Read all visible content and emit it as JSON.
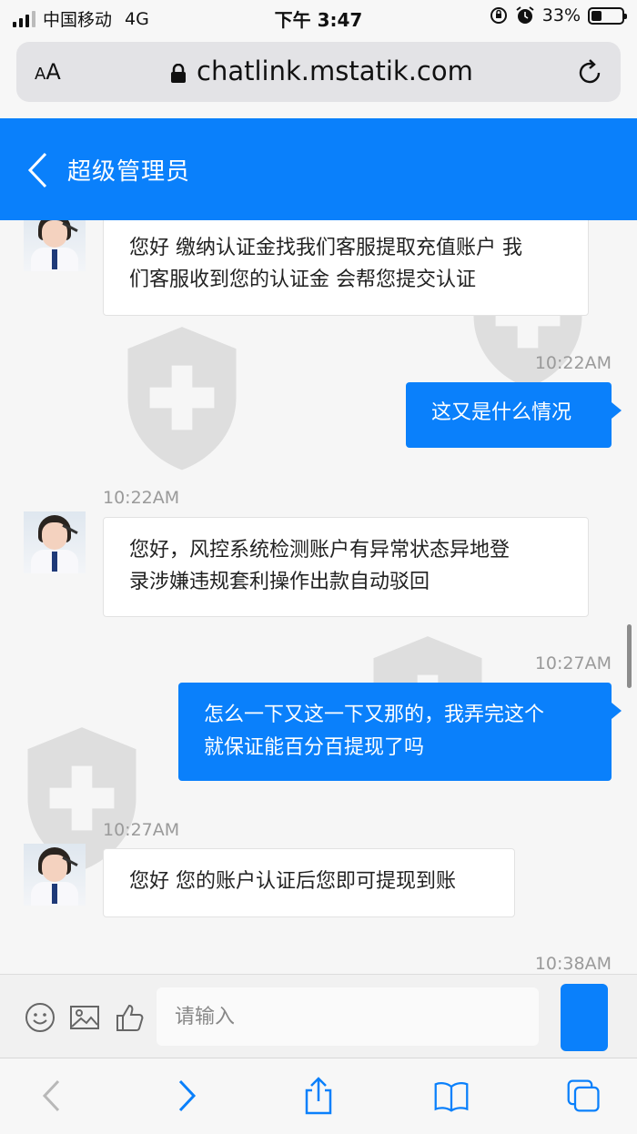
{
  "status_bar": {
    "carrier": "中国移动",
    "network": "4G",
    "time": "下午 3:47",
    "battery_percent": "33%",
    "battery_level": 0.33
  },
  "browser": {
    "text_size_label_small": "A",
    "text_size_label_large": "A",
    "url": "chatlink.mstatik.com"
  },
  "header": {
    "title": "超级管理员"
  },
  "messages": [
    {
      "direction": "in",
      "lines": [
        "您好 缴纳认证金找我们客服提取充值账户 我",
        "们客服收到您的认证金 会帮您提交认证"
      ]
    },
    {
      "direction": "out",
      "time": "10:22AM",
      "lines": [
        "这又是什么情况"
      ]
    },
    {
      "direction": "in",
      "time": "10:22AM",
      "lines": [
        "您好，风控系统检测账户有异常状态异地登",
        "录涉嫌违规套利操作出款自动驳回"
      ]
    },
    {
      "direction": "out",
      "time": "10:27AM",
      "lines": [
        "怎么一下又这一下又那的，我弄完这个",
        "就保证能百分百提现了吗"
      ]
    },
    {
      "direction": "in",
      "time": "10:27AM",
      "lines": [
        "您好 您的账户认证后您即可提现到账"
      ]
    },
    {
      "direction": "out",
      "time": "10:38AM",
      "lines": []
    }
  ],
  "input_bar": {
    "placeholder": "请输入",
    "icons": [
      "emoji-icon",
      "image-icon",
      "thumbs-up-icon"
    ]
  },
  "toolbar": {
    "icons": [
      "back-icon",
      "forward-icon",
      "share-icon",
      "bookmarks-icon",
      "tabs-icon"
    ]
  },
  "colors": {
    "accent": "#0a80fb",
    "bubble_in": "#ffffff",
    "background": "#f6f6f6"
  }
}
